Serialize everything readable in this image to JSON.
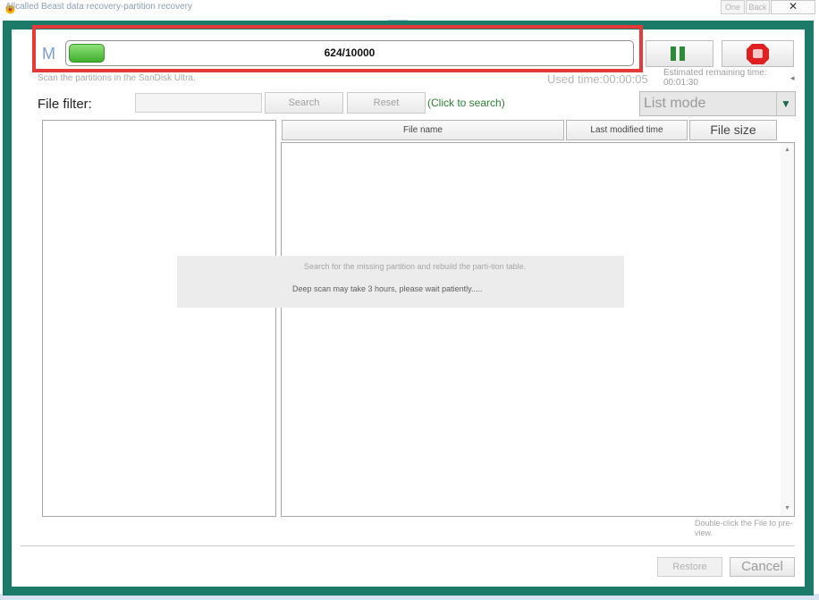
{
  "window": {
    "title": "Allcalled Beast data recovery-partition recovery",
    "one_label": "One",
    "back_label": "Back",
    "close_glyph": "✕"
  },
  "scan": {
    "mode_letter": "M",
    "progress_text": "624/10000",
    "progress_fraction": 0.0624,
    "status_text": "Scan the partitions in the SanDisk Ultra.",
    "used_time": "Used time:00:00:05",
    "estimated_label": "Estimated remaining time:",
    "estimated_value": "00:01:30",
    "pause_icon": "pause-icon",
    "stop_icon": "stop-icon"
  },
  "filter": {
    "label": "File filter:",
    "input_value": "",
    "search_label": "Search",
    "reset_label": "Reset",
    "hint": "(Click to search)",
    "view_mode": "List mode"
  },
  "table": {
    "columns": [
      "File name",
      "Last modified time",
      "File size"
    ],
    "rows": []
  },
  "message": {
    "line1": "Search for the missing partition and rebuild the parti-tion table.",
    "line2": "Deep scan may take 3 hours, please wait patiently....."
  },
  "footer": {
    "hint": "Double-click the File to pre-view.",
    "restore_label": "Restore",
    "cancel_label": "Cancel"
  },
  "colors": {
    "frame": "#1c7a68",
    "highlight": "#e63a3a",
    "progress": "#4fbf3a",
    "hint_green": "#2e7d32"
  }
}
